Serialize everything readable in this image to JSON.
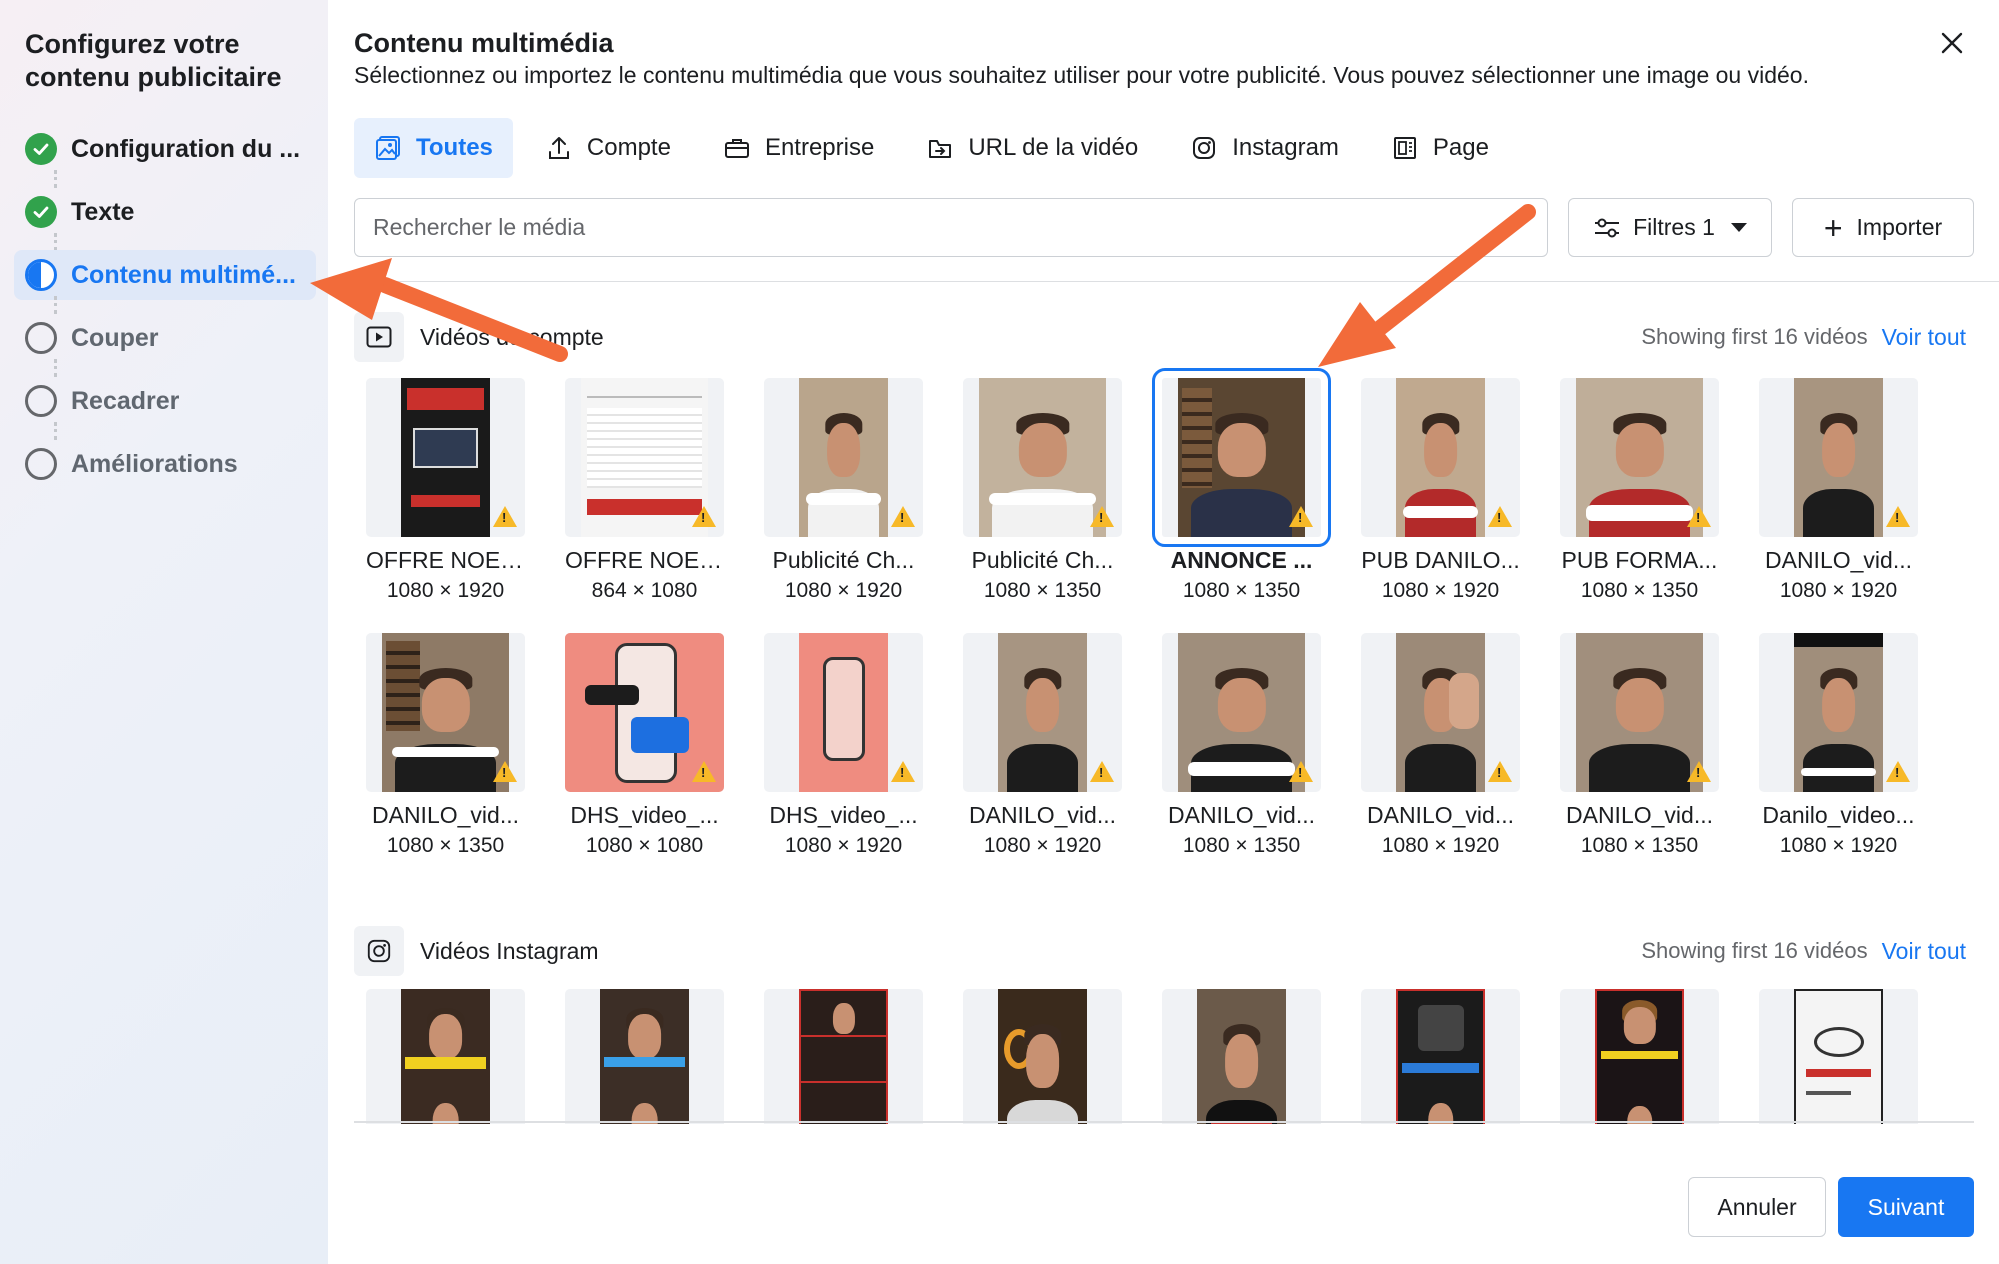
{
  "sidebar": {
    "title": "Configurez votre contenu publicitaire",
    "steps": [
      {
        "label": "Configuration du ...",
        "state": "done"
      },
      {
        "label": "Texte",
        "state": "done"
      },
      {
        "label": "Contenu multimé...",
        "state": "active"
      },
      {
        "label": "Couper",
        "state": "todo"
      },
      {
        "label": "Recadrer",
        "state": "todo"
      },
      {
        "label": "Améliorations",
        "state": "todo"
      }
    ]
  },
  "main": {
    "title": "Contenu multimédia",
    "subtitle": "Sélectionnez ou importez le contenu multimédia que vous souhaitez utiliser pour votre publicité. Vous pouvez sélectionner une image ou vidéo.",
    "tabs": [
      {
        "label": "Toutes",
        "icon": "gallery-icon"
      },
      {
        "label": "Compte",
        "icon": "upload-icon"
      },
      {
        "label": "Entreprise",
        "icon": "briefcase-icon"
      },
      {
        "label": "URL de la vidéo",
        "icon": "link-box-icon"
      },
      {
        "label": "Instagram",
        "icon": "instagram-icon"
      },
      {
        "label": "Page",
        "icon": "page-icon"
      }
    ],
    "search_placeholder": "Rechercher le média",
    "filter_label": "Filtres 1",
    "import_label": "Importer",
    "account_section": {
      "title": "Vidéos du compte",
      "meta": "Showing first 16 vidéos",
      "link": "Voir tout"
    },
    "account_videos": [
      {
        "name": "OFFRE NOEL...",
        "dims": "1080 × 1920"
      },
      {
        "name": "OFFRE NOEL...",
        "dims": "864 × 1080"
      },
      {
        "name": "Publicité Ch...",
        "dims": "1080 × 1920"
      },
      {
        "name": "Publicité Ch...",
        "dims": "1080 × 1350"
      },
      {
        "name": "ANNONCE ...",
        "dims": "1080 × 1350"
      },
      {
        "name": "PUB DANILO...",
        "dims": "1080 × 1920"
      },
      {
        "name": "PUB FORMA...",
        "dims": "1080 × 1350"
      },
      {
        "name": "DANILO_vid...",
        "dims": "1080 × 1920"
      },
      {
        "name": "DANILO_vid...",
        "dims": "1080 × 1350"
      },
      {
        "name": "DHS_video_...",
        "dims": "1080 × 1080"
      },
      {
        "name": "DHS_video_...",
        "dims": "1080 × 1920"
      },
      {
        "name": "DANILO_vid...",
        "dims": "1080 × 1920"
      },
      {
        "name": "DANILO_vid...",
        "dims": "1080 × 1350"
      },
      {
        "name": "DANILO_vid...",
        "dims": "1080 × 1920"
      },
      {
        "name": "DANILO_vid...",
        "dims": "1080 × 1350"
      },
      {
        "name": "Danilo_video...",
        "dims": "1080 × 1920"
      }
    ],
    "instagram_section": {
      "title": "Vidéos Instagram",
      "meta": "Showing first 16 vidéos",
      "link": "Voir tout"
    },
    "footer": {
      "cancel_label": "Annuler",
      "next_label": "Suivant"
    }
  },
  "colors": {
    "accent": "#1877f2",
    "done": "#31a24c",
    "warning": "#f7b928",
    "annotation_arrow": "#f26b3a"
  }
}
